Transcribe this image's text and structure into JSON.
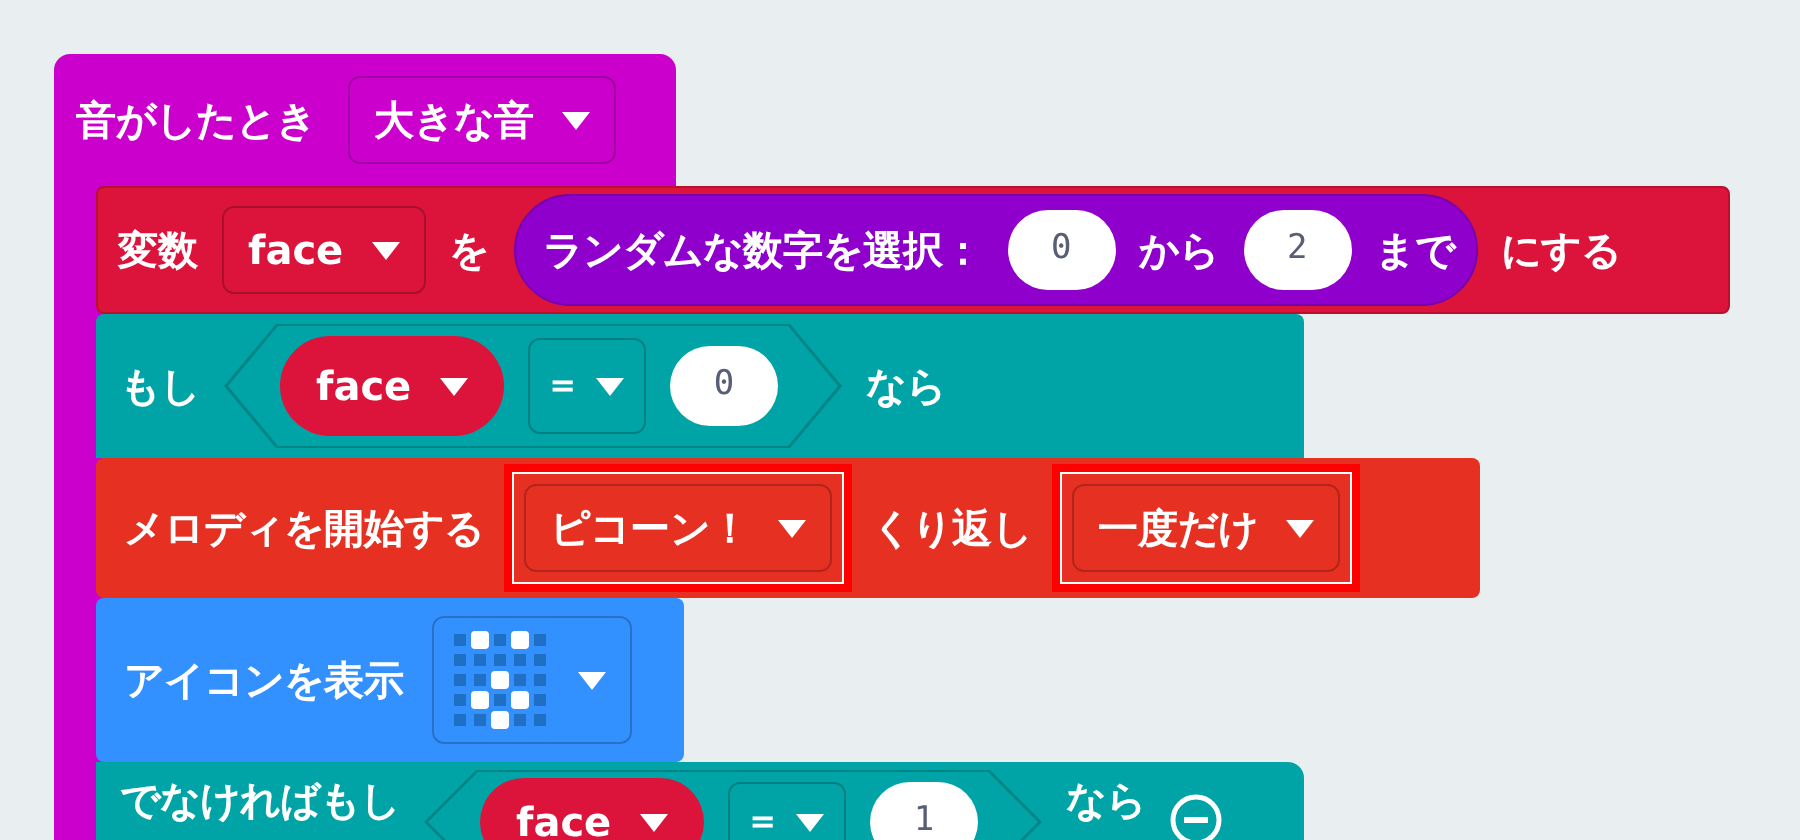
{
  "event_block": {
    "label": "音がしたとき",
    "dropdown": "大きな音"
  },
  "set_block": {
    "label": "変数",
    "variable": "face",
    "connector": "を",
    "random": {
      "label": "ランダムな数字を選択：",
      "from": "0",
      "from_label": "から",
      "to": "2",
      "to_label": "まで"
    },
    "suffix": "にする"
  },
  "if_block": {
    "label": "もし",
    "condition": {
      "variable": "face",
      "operator": "=",
      "value": "0"
    },
    "then_label": "なら",
    "body": [
      {
        "kind": "melody",
        "label": "メロディを開始する",
        "melody": "ピコーン！",
        "melody_highlighted": true,
        "repeat_label": "くり返し",
        "repeat": "一度だけ",
        "repeat_highlighted": true
      },
      {
        "kind": "icon",
        "label": "アイコンを表示"
      }
    ],
    "else_if": {
      "label": "でなければもし",
      "condition": {
        "variable": "face",
        "operator": "=",
        "value": "1"
      },
      "then_label": "なら"
    }
  }
}
